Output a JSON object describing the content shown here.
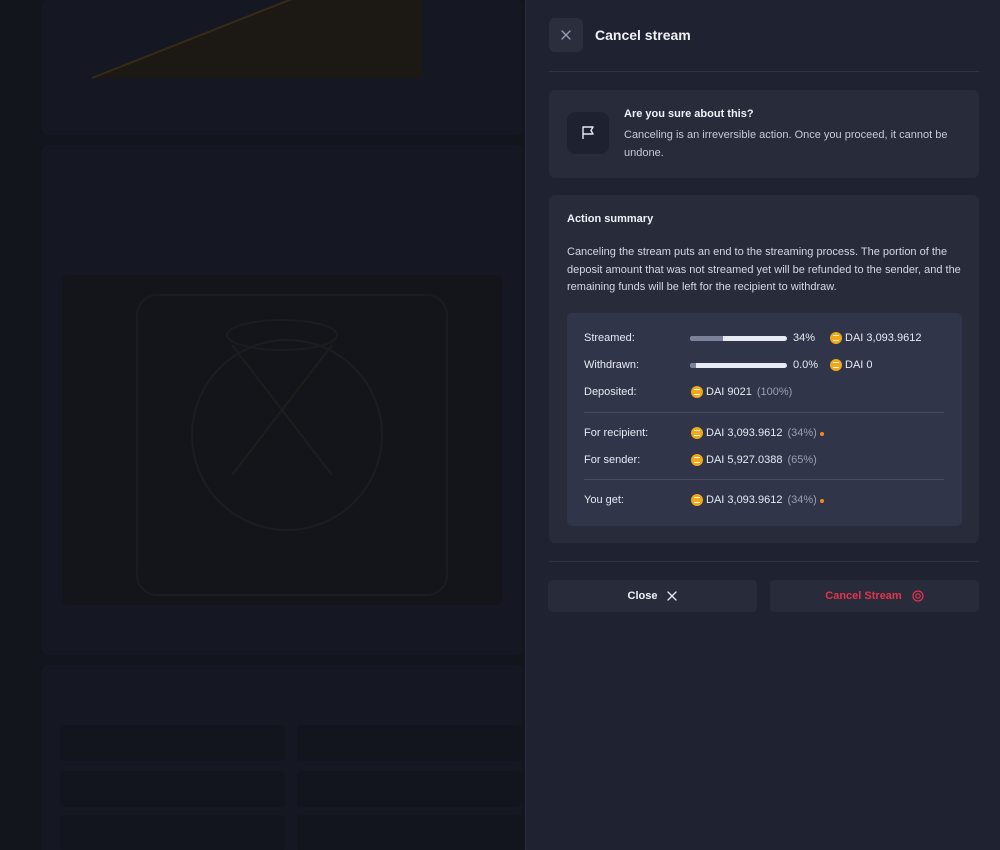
{
  "drawer": {
    "title": "Cancel stream",
    "warning": {
      "title": "Are you sure about this?",
      "text": "Canceling is an irreversible action. Once you proceed, it cannot be undone."
    },
    "summary": {
      "title": "Action summary",
      "text": "Canceling the stream puts an end to the streaming process. The portion of the deposit amount that was not streamed yet will be refunded to the sender, and the remaining funds will be left for the recipient to withdraw.",
      "streamed": {
        "label": "Streamed:",
        "percent": "34%",
        "progress": 0.34,
        "amount": "DAI 3,093.9612"
      },
      "withdrawn": {
        "label": "Withdrawn:",
        "percent": "0.0%",
        "progress": 0.0,
        "amount": "DAI 0"
      },
      "deposited": {
        "label": "Deposited:",
        "amount": "DAI 9021",
        "share": "(100%)"
      },
      "recipient": {
        "label": "For recipient:",
        "amount": "DAI 3,093.9612",
        "share": "(34%)"
      },
      "sender": {
        "label": "For sender:",
        "amount": "DAI 5,927.0388",
        "share": "(65%)"
      },
      "you_get": {
        "label": "You get:",
        "amount": "DAI 3,093.9612",
        "share": "(34%)"
      }
    },
    "buttons": {
      "close": "Close",
      "cancel_stream": "Cancel Stream"
    }
  },
  "colors": {
    "accent_danger": "#e5334d",
    "token_coin": "#f0a91c",
    "status_dot": "#f08a1c"
  },
  "icons": {
    "close": "close-icon",
    "flag": "flag-icon",
    "target": "target-icon",
    "token": "dai-token-icon"
  }
}
